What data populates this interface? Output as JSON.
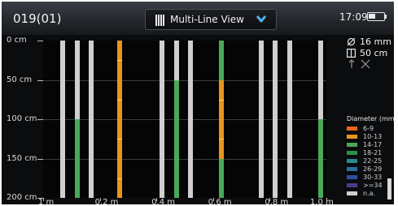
{
  "header": {
    "record_id": "019(01)",
    "view_label": "Multi-Line View",
    "clock": "17:09"
  },
  "info_panel": {
    "diameter": "16 mm",
    "spacing": "50 cm"
  },
  "chart_data": {
    "type": "bar",
    "xlabel": "",
    "ylabel": "",
    "x_tick_labels": [
      "1 m",
      "0.2 m",
      "0.4 m",
      "0.6 m",
      "0.8 m",
      "1.0 m"
    ],
    "y_tick_labels": [
      "0 cm",
      "50 cm",
      "100 cm",
      "150 cm",
      "200 cm"
    ],
    "xlim": [
      0.0,
      1.0
    ],
    "ylim": [
      0,
      200
    ],
    "grid": true,
    "legend_position": "right",
    "bars": [
      {
        "x": 0.07,
        "color": "#cfcfcf"
      },
      {
        "x": 0.12,
        "color": "#cfcfcf",
        "segments": [
          {
            "from": 100,
            "to": 200,
            "color": "#4aa85a"
          }
        ]
      },
      {
        "x": 0.17,
        "color": "#cfcfcf"
      },
      {
        "x": 0.27,
        "color": "#e8941e",
        "ticks": [
          25,
          75,
          125,
          175
        ]
      },
      {
        "x": 0.42,
        "color": "#cfcfcf"
      },
      {
        "x": 0.47,
        "color": "#cfcfcf",
        "segments": [
          {
            "from": 50,
            "to": 200,
            "color": "#4aa85a"
          }
        ]
      },
      {
        "x": 0.52,
        "color": "#cfcfcf"
      },
      {
        "x": 0.63,
        "color": "#4aa85a",
        "segments": [
          {
            "from": 50,
            "to": 150,
            "color": "#e8941e"
          }
        ],
        "ticks": [
          75,
          125
        ]
      },
      {
        "x": 0.77,
        "color": "#cfcfcf"
      },
      {
        "x": 0.82,
        "color": "#cfcfcf"
      },
      {
        "x": 0.87,
        "color": "#cfcfcf"
      },
      {
        "x": 0.98,
        "color": "#cfcfcf",
        "segments": [
          {
            "from": 100,
            "to": 200,
            "color": "#4aa85a"
          }
        ]
      }
    ]
  },
  "legend": {
    "title": "Diameter (mm",
    "items": [
      {
        "label": "6-9",
        "color": "#e8641e"
      },
      {
        "label": "10-13",
        "color": "#e8941e"
      },
      {
        "label": "14-17",
        "color": "#4aa85a"
      },
      {
        "label": "18-21",
        "color": "#2f8e4a"
      },
      {
        "label": "22-25",
        "color": "#2a8a8c"
      },
      {
        "label": "26-29",
        "color": "#2a6f9c"
      },
      {
        "label": "30-33",
        "color": "#2f4f9c"
      },
      {
        "label": ">=34",
        "color": "#4a3c8c"
      },
      {
        "label": "n.a.",
        "color": "#d0d0d0"
      }
    ]
  }
}
